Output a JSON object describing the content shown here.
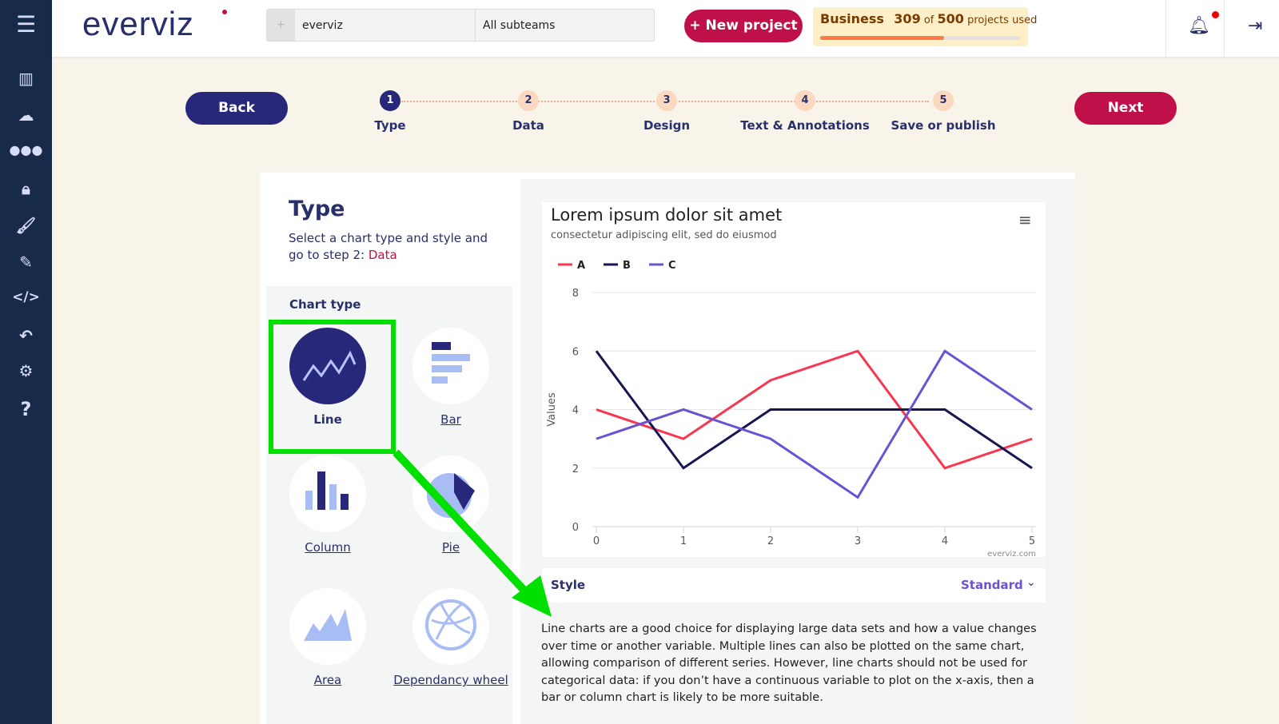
{
  "sidebar": {
    "items": [
      "menu-icon",
      "chart-icon",
      "cloud-icon",
      "team-icon",
      "lock-icon",
      "brush-icon",
      "edit-icon",
      "code-icon",
      "undo-icon",
      "settings-icon",
      "help-icon"
    ]
  },
  "header": {
    "logo": "everviz",
    "team": "everviz",
    "subteam": "All subteams",
    "new_project": "+ New project",
    "plan": "Business",
    "used": "309",
    "of": "of",
    "total": "500",
    "used_suffix": "projects used",
    "usage_fraction": 0.618
  },
  "steps": {
    "back": "Back",
    "next": "Next",
    "items": [
      {
        "n": "1",
        "label": "Type"
      },
      {
        "n": "2",
        "label": "Data"
      },
      {
        "n": "3",
        "label": "Design"
      },
      {
        "n": "4",
        "label": "Text & Annotations"
      },
      {
        "n": "5",
        "label": "Save or publish"
      }
    ]
  },
  "panel": {
    "title": "Type",
    "intro": "Select a chart type and style and go to step 2: ",
    "intro_link": "Data",
    "chart_type_heading": "Chart type",
    "types": [
      {
        "label": "Line",
        "selected": true
      },
      {
        "label": "Bar"
      },
      {
        "label": "Column"
      },
      {
        "label": "Pie"
      },
      {
        "label": "Area"
      },
      {
        "label": "Dependancy wheel"
      }
    ]
  },
  "style": {
    "label": "Style",
    "value": "Standard"
  },
  "description": "Line charts are a good choice for displaying large data sets and how a value changes over time or another variable. Multiple lines can also be plotted on the same chart, allowing comparison of different series. However, line charts should not be used for categorical data: if you don’t have a continuous variable to plot on the x-axis, then a bar or column chart is likely to be more suitable.",
  "chart_data": {
    "type": "line",
    "title": "Lorem ipsum dolor sit amet",
    "subtitle": "consectetur adipiscing elit, sed do eiusmod",
    "ylabel": "Values",
    "xlabel": "",
    "credits": "everviz.com",
    "x": [
      0,
      1,
      2,
      3,
      4,
      5
    ],
    "ylim": [
      0,
      8
    ],
    "yticks": [
      0,
      2,
      4,
      6,
      8
    ],
    "grid": true,
    "legend": "top-left",
    "series": [
      {
        "name": "A",
        "color": "#f7364f",
        "values": [
          4,
          3,
          5,
          6,
          2,
          3
        ]
      },
      {
        "name": "B",
        "color": "#161650",
        "values": [
          6,
          2,
          4,
          4,
          4,
          2
        ]
      },
      {
        "name": "C",
        "color": "#6a52d4",
        "values": [
          3,
          4,
          3,
          1,
          6,
          4
        ]
      }
    ]
  },
  "colors": {
    "sidebar": "#172a4a",
    "primary": "#28287a",
    "accent": "#c0104a",
    "highlight": "#00e000"
  }
}
